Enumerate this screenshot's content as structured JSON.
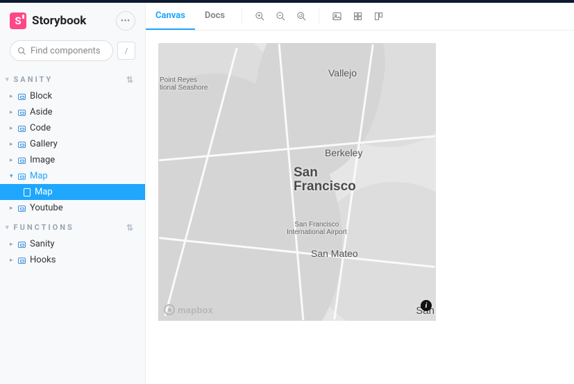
{
  "brand": {
    "logo_letter": "S",
    "name": "Storybook",
    "menu_glyph": "•••"
  },
  "search": {
    "placeholder": "Find components",
    "shortcut": "/"
  },
  "groups": [
    {
      "label": "Sanity",
      "items": [
        {
          "label": "Block"
        },
        {
          "label": "Aside"
        },
        {
          "label": "Code"
        },
        {
          "label": "Gallery"
        },
        {
          "label": "Image"
        },
        {
          "label": "Map",
          "expanded": true,
          "children": [
            {
              "label": "Map",
              "selected": true
            }
          ]
        },
        {
          "label": "Youtube"
        }
      ]
    },
    {
      "label": "Functions",
      "items": [
        {
          "label": "Sanity"
        },
        {
          "label": "Hooks"
        }
      ]
    }
  ],
  "tabs": {
    "canvas": "Canvas",
    "docs": "Docs"
  },
  "map": {
    "attribution": "mapbox",
    "info_glyph": "i",
    "labels": {
      "vallejo": "Vallejo",
      "berkeley": "Berkeley",
      "sf_line1": "San",
      "sf_line2": "Francisco",
      "sfo_line1": "San Francisco",
      "sfo_line2": "International Airport",
      "sanmateo": "San Mateo",
      "ptreyes_line1": "Point Reyes",
      "ptreyes_line2": "tional Seashore",
      "san_cut": "San"
    }
  }
}
